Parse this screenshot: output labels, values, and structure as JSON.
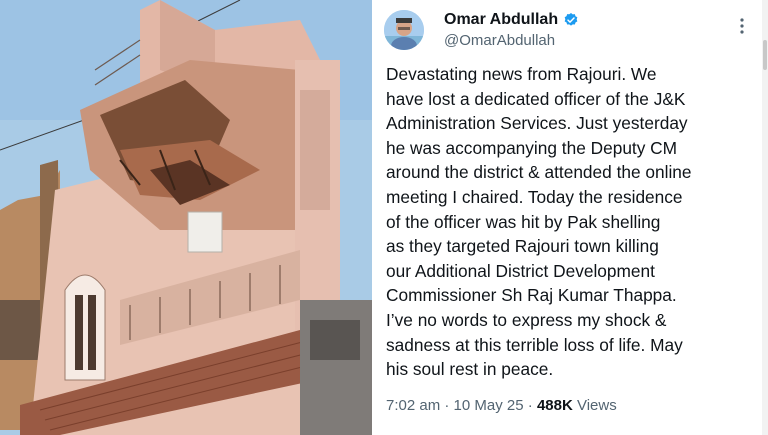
{
  "tweet": {
    "author_name": "Omar Abdullah",
    "handle": "@OmarAbdullah",
    "text": "Devastating news from Rajouri. We\nhave lost a dedicated officer of the J&K\nAdministration Services. Just yesterday\nhe was accompanying the Deputy CM\naround the district & attended the online\nmeeting I chaired. Today the residence\nof the officer was hit by Pak shelling\nas they targeted Rajouri town killing\nour Additional District Development\nCommissioner Sh Raj Kumar Thappa.\nI’ve no words to express my shock &\nsadness at this terrible loss of life. May\nhis soul rest in peace.",
    "time": "7:02 am",
    "separator": " · ",
    "date": "10 May 25",
    "views_count": "488K",
    "views_label": " Views"
  },
  "icons": {
    "verified": "verified-badge-icon",
    "more": "more-options-icon"
  },
  "colors": {
    "verified_blue": "#1d9bf0",
    "text_primary": "#0f1419",
    "text_secondary": "#536471"
  }
}
